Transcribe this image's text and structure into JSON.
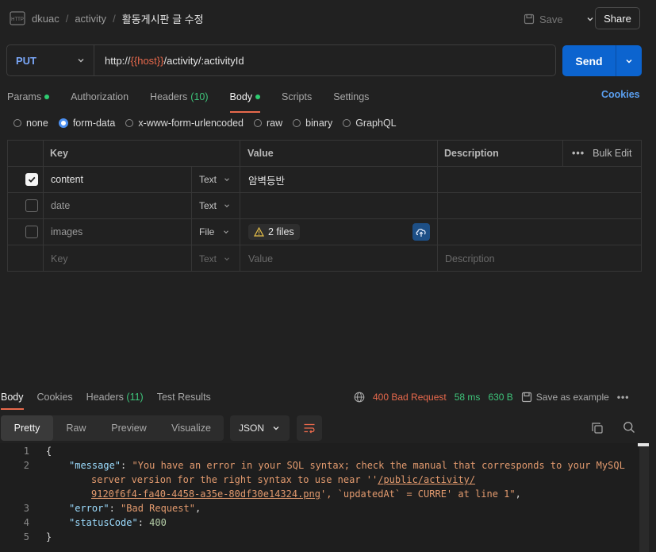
{
  "header": {
    "workspace": "dkuac",
    "collection": "activity",
    "request_name": "활동게시판 글 수정",
    "save_label": "Save",
    "share_label": "Share"
  },
  "request": {
    "method": "PUT",
    "url_prefix": "http://",
    "url_var": "{{host}}",
    "url_suffix": "/activity/:activityId",
    "send_label": "Send"
  },
  "req_tabs": {
    "params": "Params",
    "authorization": "Authorization",
    "headers": "Headers",
    "headers_count": "(10)",
    "body": "Body",
    "scripts": "Scripts",
    "settings": "Settings",
    "cookies": "Cookies"
  },
  "body_types": [
    "none",
    "form-data",
    "x-www-form-urlencoded",
    "raw",
    "binary",
    "GraphQL"
  ],
  "body_type_selected": "form-data",
  "table": {
    "headers": {
      "key": "Key",
      "value": "Value",
      "description": "Description",
      "bulk_edit": "Bulk Edit"
    },
    "rows": [
      {
        "checked": true,
        "key": "content",
        "type": "Text",
        "value": "암벽등반",
        "description": ""
      },
      {
        "checked": false,
        "key": "date",
        "type": "Text",
        "value": "",
        "description": ""
      },
      {
        "checked": false,
        "key": "images",
        "type": "File",
        "value": "2 files",
        "description": ""
      }
    ],
    "placeholder": {
      "key": "Key",
      "type": "Text",
      "value": "Value",
      "description": "Description"
    }
  },
  "response": {
    "tabs": {
      "body": "Body",
      "cookies": "Cookies",
      "headers": "Headers",
      "headers_count": "(11)",
      "test_results": "Test Results"
    },
    "status": "400 Bad Request",
    "time": "58 ms",
    "size": "630 B",
    "save_example": "Save as example",
    "views": [
      "Pretty",
      "Raw",
      "Preview",
      "Visualize"
    ],
    "format": "JSON",
    "line_numbers": [
      "1",
      "2",
      "",
      "",
      "3",
      "4",
      "5"
    ],
    "code": {
      "open": "{",
      "message_key": "\"message\"",
      "message_line1": "\"You have an error in your SQL syntax; check the manual that corresponds to your MySQL",
      "message_line2_a": "server version for the right syntax to use near ''",
      "message_line2_link": "/public/activity/",
      "message_line3_link": "9120f6f4-fa40-4458-a35e-80df30e14324.png",
      "message_line3_b": "', `updatedAt` = CURRE' at line 1\"",
      "error_key": "\"error\"",
      "error_val": "\"Bad Request\"",
      "status_key": "\"statusCode\"",
      "status_val": "400",
      "close": "}"
    }
  },
  "colors": {
    "accent": "#e8694c",
    "send": "#0c64cf",
    "link": "#5a9ff0",
    "success": "#3ec47a"
  }
}
